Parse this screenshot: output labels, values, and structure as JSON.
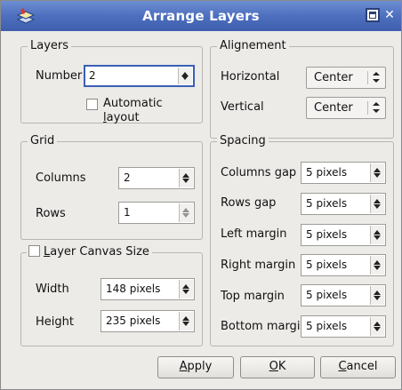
{
  "window": {
    "title": "Arrange Layers"
  },
  "layers": {
    "legend": "Layers",
    "number_label": "Number",
    "number_value": "2",
    "auto_layout_pre": "Automatic ",
    "auto_layout_mn": "l",
    "auto_layout_post": "ayout",
    "auto_layout_checked": false
  },
  "alignment": {
    "legend": "Alignement",
    "horizontal_label": "Horizontal",
    "horizontal_value": "Center",
    "vertical_label": "Vertical",
    "vertical_value": "Center"
  },
  "grid": {
    "legend": "Grid",
    "columns_label": "Columns",
    "columns_value": "2",
    "rows_label": "Rows",
    "rows_value": "1"
  },
  "spacing": {
    "legend": "Spacing",
    "columns_gap_label": "Columns gap",
    "columns_gap_value": "5 pixels",
    "rows_gap_label": "Rows gap",
    "rows_gap_value": "5 pixels",
    "left_margin_label": "Left margin",
    "left_margin_value": "5 pixels",
    "right_margin_label": "Right margin",
    "right_margin_value": "5 pixels",
    "top_margin_label": "Top margin",
    "top_margin_value": "5 pixels",
    "bottom_margin_label": "Bottom margin",
    "bottom_margin_value": "5 pixels"
  },
  "canvas": {
    "legend_mn": "L",
    "legend_rest": "ayer Canvas Size",
    "checked": false,
    "width_label": "Width",
    "width_value": "148 pixels",
    "height_label": "Height",
    "height_value": "235 pixels"
  },
  "buttons": {
    "apply_mn": "A",
    "apply_rest": "pply",
    "ok_mn": "O",
    "ok_rest": "K",
    "cancel_mn": "C",
    "cancel_rest": "ancel"
  },
  "icons": {
    "app": "arrange-layers-app-icon",
    "maximize": "maximize-icon",
    "close": "close-icon"
  }
}
